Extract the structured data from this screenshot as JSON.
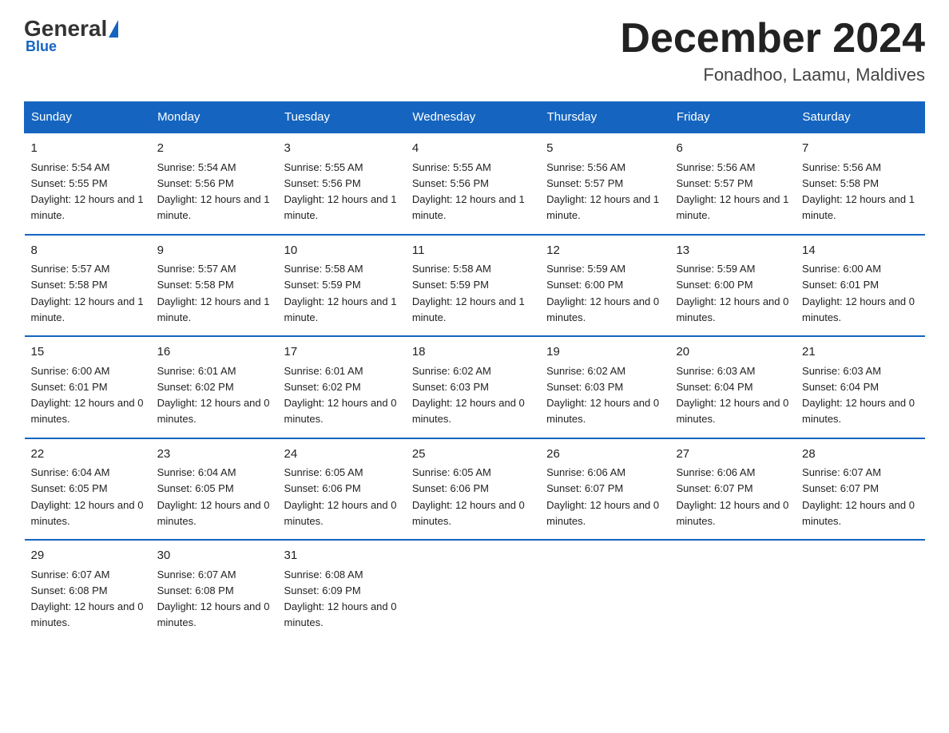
{
  "logo": {
    "general": "General",
    "blue": "Blue"
  },
  "header": {
    "title": "December 2024",
    "subtitle": "Fonadhoo, Laamu, Maldives"
  },
  "columns": [
    "Sunday",
    "Monday",
    "Tuesday",
    "Wednesday",
    "Thursday",
    "Friday",
    "Saturday"
  ],
  "weeks": [
    [
      {
        "day": "1",
        "sunrise": "5:54 AM",
        "sunset": "5:55 PM",
        "daylight": "12 hours and 1 minute."
      },
      {
        "day": "2",
        "sunrise": "5:54 AM",
        "sunset": "5:56 PM",
        "daylight": "12 hours and 1 minute."
      },
      {
        "day": "3",
        "sunrise": "5:55 AM",
        "sunset": "5:56 PM",
        "daylight": "12 hours and 1 minute."
      },
      {
        "day": "4",
        "sunrise": "5:55 AM",
        "sunset": "5:56 PM",
        "daylight": "12 hours and 1 minute."
      },
      {
        "day": "5",
        "sunrise": "5:56 AM",
        "sunset": "5:57 PM",
        "daylight": "12 hours and 1 minute."
      },
      {
        "day": "6",
        "sunrise": "5:56 AM",
        "sunset": "5:57 PM",
        "daylight": "12 hours and 1 minute."
      },
      {
        "day": "7",
        "sunrise": "5:56 AM",
        "sunset": "5:58 PM",
        "daylight": "12 hours and 1 minute."
      }
    ],
    [
      {
        "day": "8",
        "sunrise": "5:57 AM",
        "sunset": "5:58 PM",
        "daylight": "12 hours and 1 minute."
      },
      {
        "day": "9",
        "sunrise": "5:57 AM",
        "sunset": "5:58 PM",
        "daylight": "12 hours and 1 minute."
      },
      {
        "day": "10",
        "sunrise": "5:58 AM",
        "sunset": "5:59 PM",
        "daylight": "12 hours and 1 minute."
      },
      {
        "day": "11",
        "sunrise": "5:58 AM",
        "sunset": "5:59 PM",
        "daylight": "12 hours and 1 minute."
      },
      {
        "day": "12",
        "sunrise": "5:59 AM",
        "sunset": "6:00 PM",
        "daylight": "12 hours and 0 minutes."
      },
      {
        "day": "13",
        "sunrise": "5:59 AM",
        "sunset": "6:00 PM",
        "daylight": "12 hours and 0 minutes."
      },
      {
        "day": "14",
        "sunrise": "6:00 AM",
        "sunset": "6:01 PM",
        "daylight": "12 hours and 0 minutes."
      }
    ],
    [
      {
        "day": "15",
        "sunrise": "6:00 AM",
        "sunset": "6:01 PM",
        "daylight": "12 hours and 0 minutes."
      },
      {
        "day": "16",
        "sunrise": "6:01 AM",
        "sunset": "6:02 PM",
        "daylight": "12 hours and 0 minutes."
      },
      {
        "day": "17",
        "sunrise": "6:01 AM",
        "sunset": "6:02 PM",
        "daylight": "12 hours and 0 minutes."
      },
      {
        "day": "18",
        "sunrise": "6:02 AM",
        "sunset": "6:03 PM",
        "daylight": "12 hours and 0 minutes."
      },
      {
        "day": "19",
        "sunrise": "6:02 AM",
        "sunset": "6:03 PM",
        "daylight": "12 hours and 0 minutes."
      },
      {
        "day": "20",
        "sunrise": "6:03 AM",
        "sunset": "6:04 PM",
        "daylight": "12 hours and 0 minutes."
      },
      {
        "day": "21",
        "sunrise": "6:03 AM",
        "sunset": "6:04 PM",
        "daylight": "12 hours and 0 minutes."
      }
    ],
    [
      {
        "day": "22",
        "sunrise": "6:04 AM",
        "sunset": "6:05 PM",
        "daylight": "12 hours and 0 minutes."
      },
      {
        "day": "23",
        "sunrise": "6:04 AM",
        "sunset": "6:05 PM",
        "daylight": "12 hours and 0 minutes."
      },
      {
        "day": "24",
        "sunrise": "6:05 AM",
        "sunset": "6:06 PM",
        "daylight": "12 hours and 0 minutes."
      },
      {
        "day": "25",
        "sunrise": "6:05 AM",
        "sunset": "6:06 PM",
        "daylight": "12 hours and 0 minutes."
      },
      {
        "day": "26",
        "sunrise": "6:06 AM",
        "sunset": "6:07 PM",
        "daylight": "12 hours and 0 minutes."
      },
      {
        "day": "27",
        "sunrise": "6:06 AM",
        "sunset": "6:07 PM",
        "daylight": "12 hours and 0 minutes."
      },
      {
        "day": "28",
        "sunrise": "6:07 AM",
        "sunset": "6:07 PM",
        "daylight": "12 hours and 0 minutes."
      }
    ],
    [
      {
        "day": "29",
        "sunrise": "6:07 AM",
        "sunset": "6:08 PM",
        "daylight": "12 hours and 0 minutes."
      },
      {
        "day": "30",
        "sunrise": "6:07 AM",
        "sunset": "6:08 PM",
        "daylight": "12 hours and 0 minutes."
      },
      {
        "day": "31",
        "sunrise": "6:08 AM",
        "sunset": "6:09 PM",
        "daylight": "12 hours and 0 minutes."
      },
      null,
      null,
      null,
      null
    ]
  ],
  "labels": {
    "sunrise": "Sunrise:",
    "sunset": "Sunset:",
    "daylight": "Daylight:"
  }
}
